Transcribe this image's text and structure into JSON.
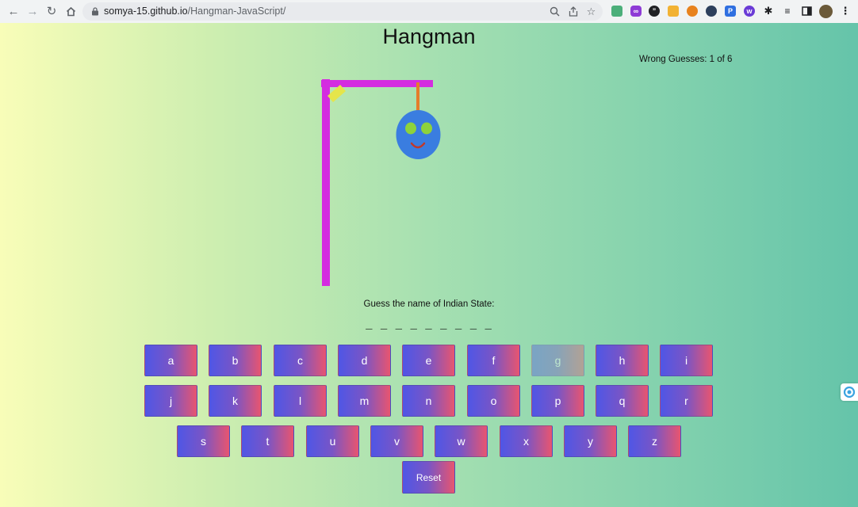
{
  "browser": {
    "url_domain": "somya-15.github.io",
    "url_path": "/Hangman-JavaScript/"
  },
  "game": {
    "title": "Hangman",
    "wrong_guesses_text": "Wrong Guesses: 1 of 6",
    "wrong_guesses": 1,
    "max_wrong": 6,
    "hint": "Guess the name of Indian State:",
    "word_display": "_ _ _ _ _ _ _ _ _",
    "disabled_letters": [
      "g"
    ],
    "keyboard_rows": [
      [
        "a",
        "b",
        "c",
        "d",
        "e",
        "f",
        "g",
        "h",
        "i"
      ],
      [
        "j",
        "k",
        "l",
        "m",
        "n",
        "o",
        "p",
        "q",
        "r"
      ],
      [
        "s",
        "t",
        "u",
        "v",
        "w",
        "x",
        "y",
        "z"
      ]
    ],
    "reset_label": "Reset"
  },
  "colors": {
    "gallows": "#d42ce0",
    "rope": "#e57c2a",
    "head": "#3a7de0",
    "eyes": "#8ed23c",
    "mouth": "#c0392b",
    "brace": "#e5e54a"
  }
}
